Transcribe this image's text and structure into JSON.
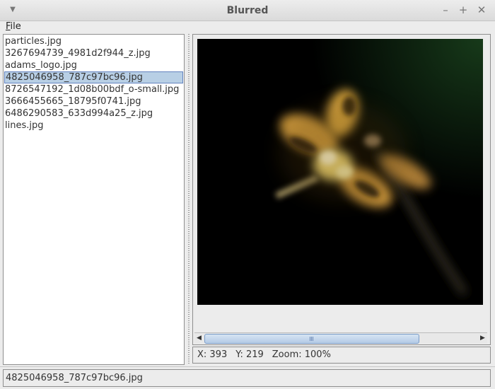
{
  "window": {
    "title": "Blurred"
  },
  "menu": {
    "file_mnemonic": "F",
    "file_rest": "ile"
  },
  "files": [
    "particles.jpg",
    "3267694739_4981d2f944_z.jpg",
    "adams_logo.jpg",
    "4825046958_787c97bc96.jpg",
    "8726547192_1d08b00bdf_o-small.jpg",
    "3666455665_18795f0741.jpg",
    "6486290583_633d994a25_z.jpg",
    "lines.jpg"
  ],
  "selected_index": 3,
  "viewer": {
    "x_text": "X: 393",
    "y_text": "Y: 219",
    "zoom_text": "Zoom: 100%",
    "image_icon": "blurred-dragonfly-photo"
  },
  "status": {
    "text": "4825046958_787c97bc96.jpg"
  },
  "icons": {
    "window_menu": "chevron-down-icon",
    "minimize": "minimize-icon",
    "maximize": "maximize-icon",
    "close": "close-icon"
  },
  "colors": {
    "selection_bg": "#b8cfe5",
    "selection_border": "#6382bf",
    "scroll_thumb": "#b4cbe6"
  }
}
